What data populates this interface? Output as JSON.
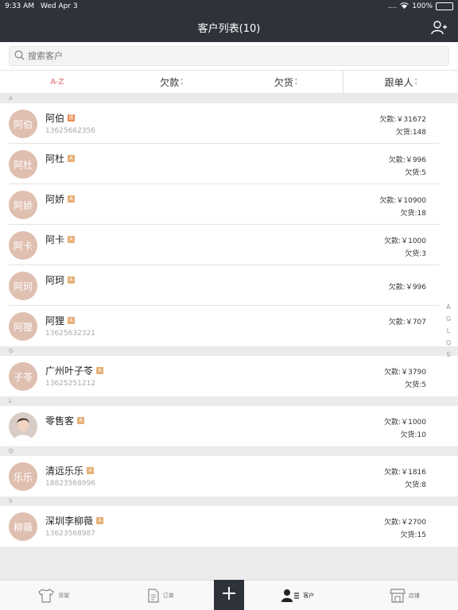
{
  "status_bar": {
    "time": "9:33 AM",
    "date": "Wed Apr 3",
    "battery": "100%",
    "signal_dots": "...."
  },
  "nav": {
    "title": "客户列表(10)",
    "add_icon": "add-user-icon"
  },
  "search": {
    "placeholder": "搜索客户",
    "icon": "search-icon"
  },
  "sort_tabs": [
    {
      "label": "A-Z"
    },
    {
      "label": "欠款"
    },
    {
      "label": "欠货"
    },
    {
      "label": "跟单人"
    }
  ],
  "sections": [
    {
      "letter": "A",
      "customers": [
        {
          "avatar": "阿伯",
          "name": "阿伯",
          "badge": "圆",
          "phone": "13625662356",
          "debt": "欠款:￥31672",
          "stock": "欠货:148"
        },
        {
          "avatar": "阿杜",
          "name": "阿杜",
          "badge": "A",
          "phone": "",
          "debt": "欠款:￥996",
          "stock": "欠货:5"
        },
        {
          "avatar": "阿娇",
          "name": "阿娇",
          "badge": "A",
          "phone": "",
          "debt": "欠款:￥10900",
          "stock": "欠货:18"
        },
        {
          "avatar": "阿卡",
          "name": "阿卡",
          "badge": "A",
          "phone": "",
          "debt": "欠款:￥1000",
          "stock": "欠货:3"
        },
        {
          "avatar": "阿珂",
          "name": "阿珂",
          "badge": "A",
          "phone": "",
          "debt": "欠款:￥996",
          "stock": ""
        },
        {
          "avatar": "阿狸",
          "name": "阿狸",
          "badge": "A",
          "phone": "13625632321",
          "debt": "欠款:￥707",
          "stock": ""
        }
      ]
    },
    {
      "letter": "G",
      "customers": [
        {
          "avatar": "子苓",
          "name": "广州叶子苓",
          "badge": "A",
          "phone": "13625251212",
          "debt": "欠款:￥3790",
          "stock": "欠货:5"
        }
      ]
    },
    {
      "letter": "L",
      "customers": [
        {
          "avatar": "",
          "name": "零售客",
          "badge": "A",
          "phone": "",
          "debt": "欠款:￥1000",
          "stock": "欠货:10"
        }
      ]
    },
    {
      "letter": "Q",
      "customers": [
        {
          "avatar": "乐乐",
          "name": "清远乐乐",
          "badge": "A",
          "phone": "18823568996",
          "debt": "欠款:￥1816",
          "stock": "欠货:8"
        }
      ]
    },
    {
      "letter": "S",
      "customers": [
        {
          "avatar": "柳薇",
          "name": "深圳李柳薇",
          "badge": "A",
          "phone": "13623568987",
          "debt": "欠款:￥2700",
          "stock": "欠货:15"
        }
      ]
    }
  ],
  "index_letters": [
    "A",
    "G",
    "L",
    "Q",
    "S"
  ],
  "tab_bar": [
    {
      "label": "货架",
      "icon": "shirt-icon"
    },
    {
      "label": "订单",
      "icon": "document-icon"
    },
    {
      "label": "",
      "icon": "plus-icon"
    },
    {
      "label": "客户",
      "icon": "customer-icon"
    },
    {
      "label": "店铺",
      "icon": "store-icon"
    }
  ],
  "colors": {
    "nav_bg": "#2e333b",
    "accent": "#e4606c",
    "avatar_bg": "#dfbfb0",
    "badge": "#e6b077"
  }
}
